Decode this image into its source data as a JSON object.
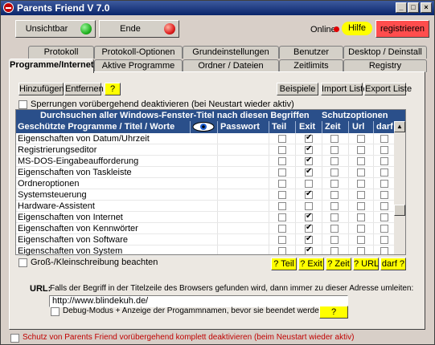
{
  "window": {
    "title": "Parents Friend V 7.0"
  },
  "topbar": {
    "unsichtbar_label": "Unsichtbar",
    "ende_label": "Ende",
    "online_label": "Online",
    "hilfe_label": "Hilfe",
    "registrieren_label": "registrieren"
  },
  "tabs_row1": [
    "Protokoll",
    "Protokoll-Optionen",
    "Grundeinstellungen",
    "Benutzer",
    "Desktop / Deinstall"
  ],
  "tabs_row2": [
    "Programme/Internet",
    "Aktive Programme",
    "Ordner / Dateien",
    "Zeitlimits",
    "Registry"
  ],
  "active_tab": "Programme/Internet",
  "toolbar": {
    "hinzufuegen": "Hinzufügen",
    "entfernen": "Entfernen",
    "help": "?",
    "beispiele": "Beispiele",
    "import": "Import Liste",
    "export": "Export Liste"
  },
  "sperrungen_label": "Sperrungen vorübergehend deaktivieren (bei Neustart wieder aktiv)",
  "grid": {
    "header1_left": "Durchsuchen aller Windows-Fenster-Titel nach diesen Begriffen",
    "header1_right": "Schutzoptionen",
    "columns": [
      "Geschützte Programme / Titel / Worte",
      "Passwort",
      "Teil",
      "Exit",
      "Zeit",
      "Url",
      "darf"
    ],
    "rows": [
      {
        "name": "Eigenschaften von Datum/Uhrzeit",
        "teil": false,
        "exit": true,
        "zeit": false,
        "url": false,
        "darf": false
      },
      {
        "name": "Registrierungseditor",
        "teil": false,
        "exit": true,
        "zeit": false,
        "url": false,
        "darf": false
      },
      {
        "name": "MS-DOS-Eingabeaufforderung",
        "teil": false,
        "exit": true,
        "zeit": false,
        "url": false,
        "darf": false
      },
      {
        "name": "Eigenschaften von Taskleiste",
        "teil": false,
        "exit": true,
        "zeit": false,
        "url": false,
        "darf": false
      },
      {
        "name": "Ordneroptionen",
        "teil": false,
        "exit": false,
        "zeit": false,
        "url": false,
        "darf": false
      },
      {
        "name": "Systemsteuerung",
        "teil": false,
        "exit": true,
        "zeit": false,
        "url": false,
        "darf": false
      },
      {
        "name": "Hardware-Assistent",
        "teil": false,
        "exit": false,
        "zeit": false,
        "url": false,
        "darf": false
      },
      {
        "name": "Eigenschaften von Internet",
        "teil": false,
        "exit": true,
        "zeit": false,
        "url": false,
        "darf": false
      },
      {
        "name": "Eigenschaften von Kennwörter",
        "teil": false,
        "exit": true,
        "zeit": false,
        "url": false,
        "darf": false
      },
      {
        "name": "Eigenschaften von Software",
        "teil": false,
        "exit": true,
        "zeit": false,
        "url": false,
        "darf": false
      },
      {
        "name": "Eigenschaften von System",
        "teil": false,
        "exit": true,
        "zeit": false,
        "url": false,
        "darf": false
      }
    ]
  },
  "gross_klein_label": "Groß-/Kleinschreibung beachten",
  "help_buttons": [
    "? Teil",
    "? Exit",
    "? Zeit",
    "? URL",
    "darf ?"
  ],
  "url_section": {
    "label": "URL:",
    "description": "Falls der Begriff in der Titelzeile des Browsers gefunden wird, dann immer zu dieser Adresse umleiten:",
    "value": "http://www.blindekuh.de/",
    "debug_label": "Debug-Modus + Anzeige der Progammnamen, bevor sie beendet werden",
    "help": "?"
  },
  "bottom_label": "Schutz von Parents Friend vorübergehend komplett deaktivieren (beim Neustart wieder aktiv)",
  "colors": {
    "title_bar": "#0a246a",
    "grid_header": "#2a4f8a",
    "hilfe": "#ffff00",
    "register": "#ff4d4d",
    "green_led": "#22b422",
    "red_led": "#e02020",
    "warning_text": "#c00000"
  }
}
